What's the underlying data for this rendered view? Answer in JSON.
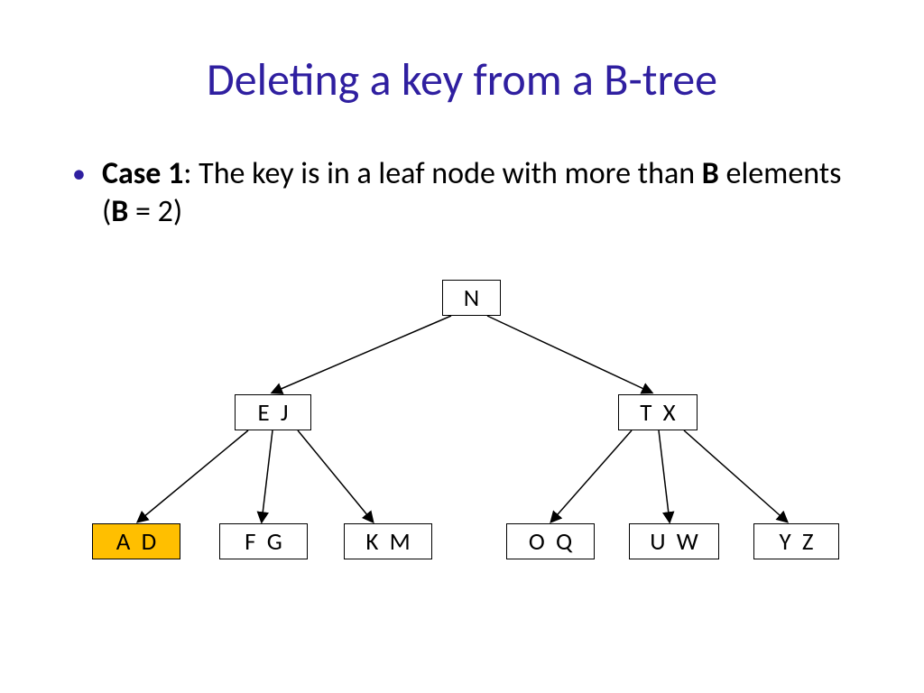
{
  "title": "Deleting a key from a B-tree",
  "bullet": {
    "case_label": "Case 1",
    "rest1": ": The key is in a leaf node with more than ",
    "b1": "B",
    "rest2": " elements (",
    "b2": "B",
    "rest3": " = 2)"
  },
  "tree": {
    "root": "N",
    "mid_left": "E  J",
    "mid_right": "T  X",
    "leaf1": "A  D",
    "leaf2": "F  G",
    "leaf3": "K  M",
    "leaf4": "O  Q",
    "leaf5": "U  W",
    "leaf6": "Y  Z"
  }
}
